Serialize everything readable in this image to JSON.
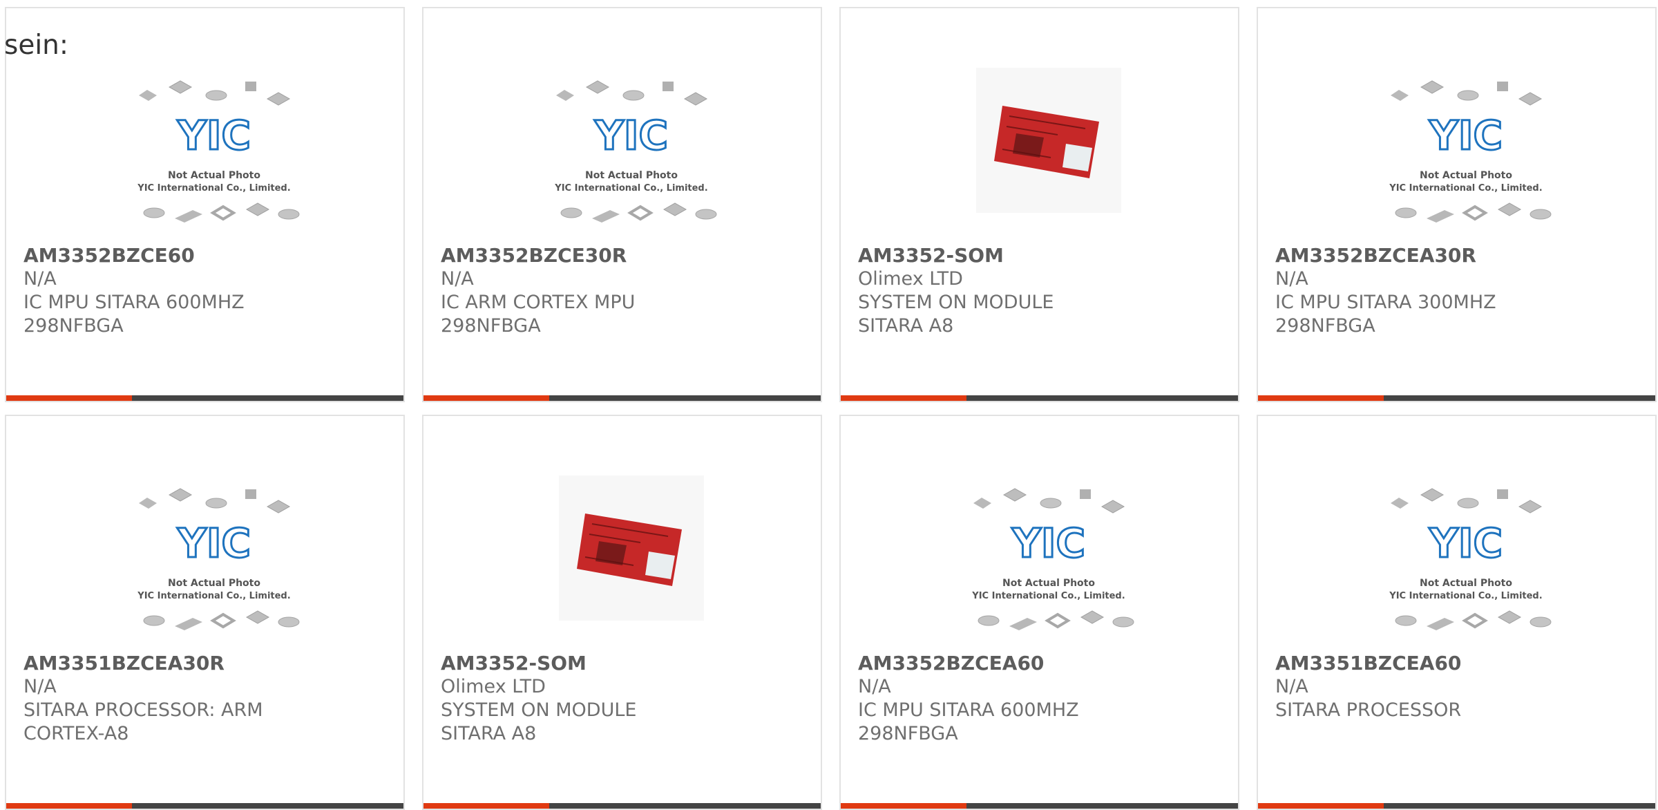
{
  "leading_text": "sein:",
  "colors": {
    "accent": "#e03a12",
    "bar": "#444444",
    "card_border": "#e2e2e2",
    "text_primary": "#5c5c5c",
    "text_secondary": "#6f6f6f",
    "board_red": "#c62828",
    "logo_blue": "#1e73be"
  },
  "placeholder_logo": {
    "mark": "YIC",
    "line1": "Not Actual Photo",
    "line2": "YIC International Co., Limited."
  },
  "products": [
    {
      "part": "AM3352BZCE60",
      "manufacturer": "N/A",
      "description": "IC MPU SITARA 600MHZ 298NFBGA",
      "image": "placeholder-photo"
    },
    {
      "part": "AM3352BZCE30R",
      "manufacturer": "N/A",
      "description": "IC ARM CORTEX MPU 298NFBGA",
      "image": "placeholder-photo"
    },
    {
      "part": "AM3352-SOM",
      "manufacturer": "Olimex LTD",
      "description": "SYSTEM ON MODULE SITARA A8",
      "image": "board-photo"
    },
    {
      "part": "AM3352BZCEA30R",
      "manufacturer": "N/A",
      "description": "IC MPU SITARA 300MHZ 298NFBGA",
      "image": "placeholder-photo"
    },
    {
      "part": "AM3351BZCEA30R",
      "manufacturer": "N/A",
      "description": "SITARA PROCESSOR: ARM CORTEX-A8",
      "image": "placeholder-photo"
    },
    {
      "part": "AM3352-SOM",
      "manufacturer": "Olimex LTD",
      "description": "SYSTEM ON MODULE SITARA A8",
      "image": "board-photo"
    },
    {
      "part": "AM3352BZCEA60",
      "manufacturer": "N/A",
      "description": "IC MPU SITARA 600MHZ 298NFBGA",
      "image": "placeholder-photo"
    },
    {
      "part": "AM3351BZCEA60",
      "manufacturer": "N/A",
      "description": "SITARA PROCESSOR",
      "image": "placeholder-photo"
    }
  ]
}
